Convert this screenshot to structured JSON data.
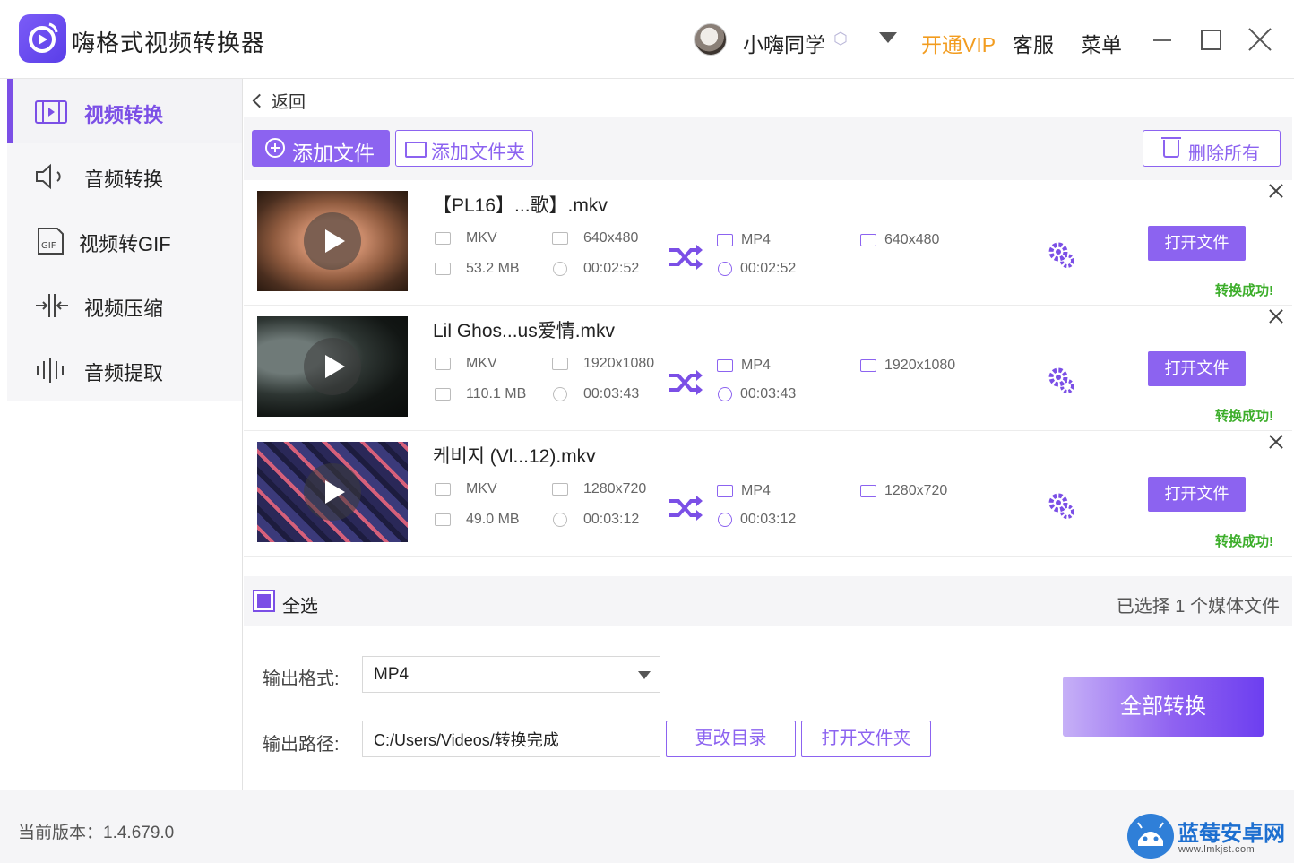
{
  "app": {
    "title": "嗨格式视频转换器",
    "username": "小嗨同学",
    "vip": "开通VIP",
    "service": "客服",
    "menu": "菜单"
  },
  "sidebar": {
    "items": [
      {
        "label": "视频转换",
        "icon": "video-convert-icon",
        "active": true
      },
      {
        "label": "音频转换",
        "icon": "audio-convert-icon",
        "active": false
      },
      {
        "label": "视频转GIF",
        "icon": "gif-icon",
        "active": false
      },
      {
        "label": "视频压缩",
        "icon": "compress-icon",
        "active": false
      },
      {
        "label": "音频提取",
        "icon": "audio-wave-icon",
        "active": false
      }
    ]
  },
  "nav": {
    "back": "返回"
  },
  "toolbar": {
    "add_file": "添加文件",
    "add_folder": "添加文件夹",
    "delete_all": "删除所有"
  },
  "files": [
    {
      "name": "【PL16】...歌】.mkv",
      "src_format": "MKV",
      "src_resolution": "640x480",
      "src_size": "53.2 MB",
      "src_duration": "00:02:52",
      "out_format": "MP4",
      "out_resolution": "640x480",
      "out_duration": "00:02:52",
      "open_label": "打开文件",
      "status": "转换成功!"
    },
    {
      "name": "Lil Ghos...us爱情.mkv",
      "src_format": "MKV",
      "src_resolution": "1920x1080",
      "src_size": "110.1 MB",
      "src_duration": "00:03:43",
      "out_format": "MP4",
      "out_resolution": "1920x1080",
      "out_duration": "00:03:43",
      "open_label": "打开文件",
      "status": "转换成功!"
    },
    {
      "name": "케비지 (Vl...12).mkv",
      "src_format": "MKV",
      "src_resolution": "1280x720",
      "src_size": "49.0 MB",
      "src_duration": "00:03:12",
      "out_format": "MP4",
      "out_resolution": "1280x720",
      "out_duration": "00:03:12",
      "open_label": "打开文件",
      "status": "转换成功!"
    }
  ],
  "selection": {
    "select_all": "全选",
    "count_text": "已选择 1 个媒体文件"
  },
  "output": {
    "format_label": "输出格式:",
    "format_value": "MP4",
    "path_label": "输出路径:",
    "path_value": "C:/Users/Videos/转换完成",
    "change_dir": "更改目录",
    "open_folder": "打开文件夹",
    "convert_all": "全部转换"
  },
  "footer": {
    "version": "当前版本：1.4.679.0"
  },
  "watermark": {
    "title": "蓝莓安卓网",
    "url": "www.lmkjst.com"
  },
  "colors": {
    "accent": "#8c63f0",
    "vip": "#f29c1f",
    "success": "#3dae2b"
  }
}
